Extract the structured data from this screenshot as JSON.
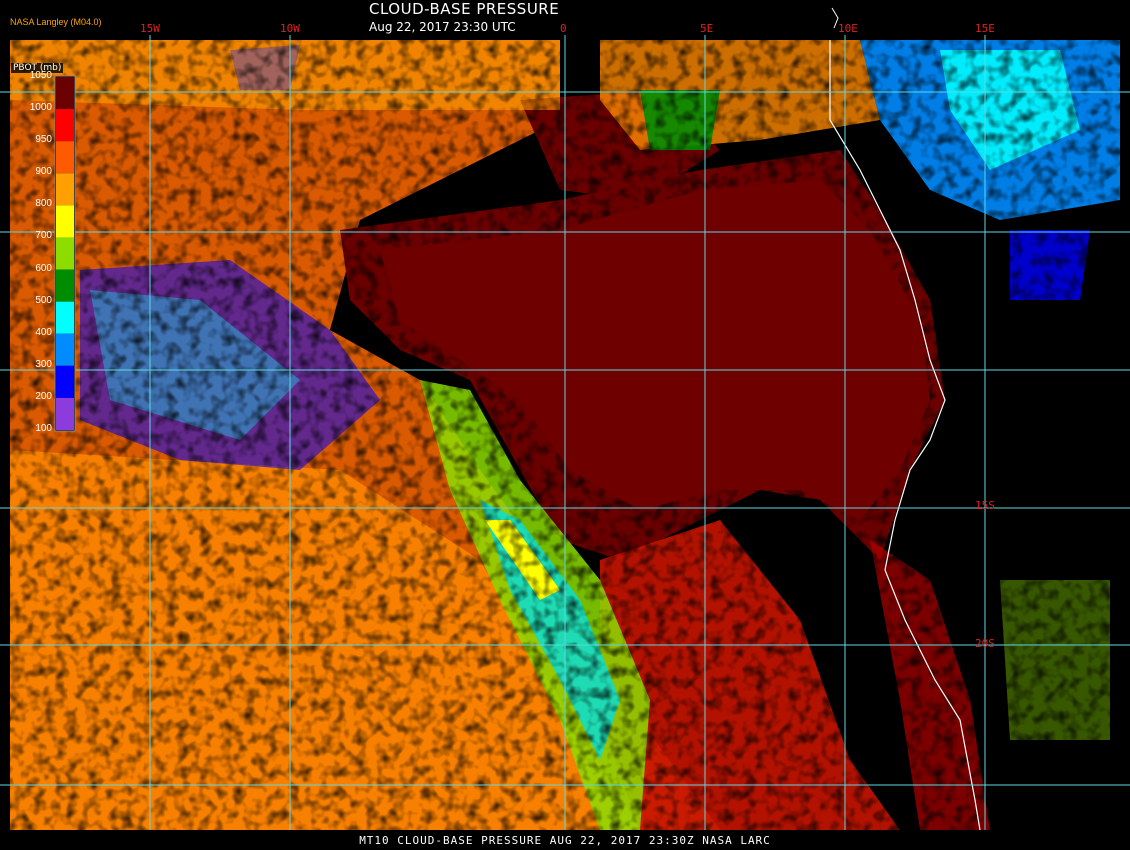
{
  "header": {
    "title": "CLOUD-BASE PRESSURE",
    "subtitle": "Aug 22, 2017 23:30 UTC",
    "credit": "NASA Langley (M04.0)"
  },
  "footer": {
    "text": "MT10  CLOUD-BASE PRESSURE   AUG 22, 2017 23:30Z   NASA LARC"
  },
  "legend": {
    "unit_label": "PBOT (mb)",
    "ticks": [
      "1050",
      "1000",
      "950",
      "900",
      "800",
      "700",
      "600",
      "500",
      "400",
      "300",
      "200",
      "100"
    ],
    "colors": [
      "#6a0000",
      "#ff0000",
      "#ff5a00",
      "#ffa000",
      "#ffff00",
      "#8cdc00",
      "#008c00",
      "#00ffff",
      "#008cff",
      "#0000ff",
      "#8c3cdc"
    ]
  },
  "map": {
    "longitude_labels": [
      "15W",
      "10W",
      "0",
      "5E",
      "10E",
      "15E"
    ],
    "latitude_labels": [
      "15S",
      "20S"
    ],
    "grid_color": "#5fd7e0",
    "coast_color": "#ffffff"
  }
}
